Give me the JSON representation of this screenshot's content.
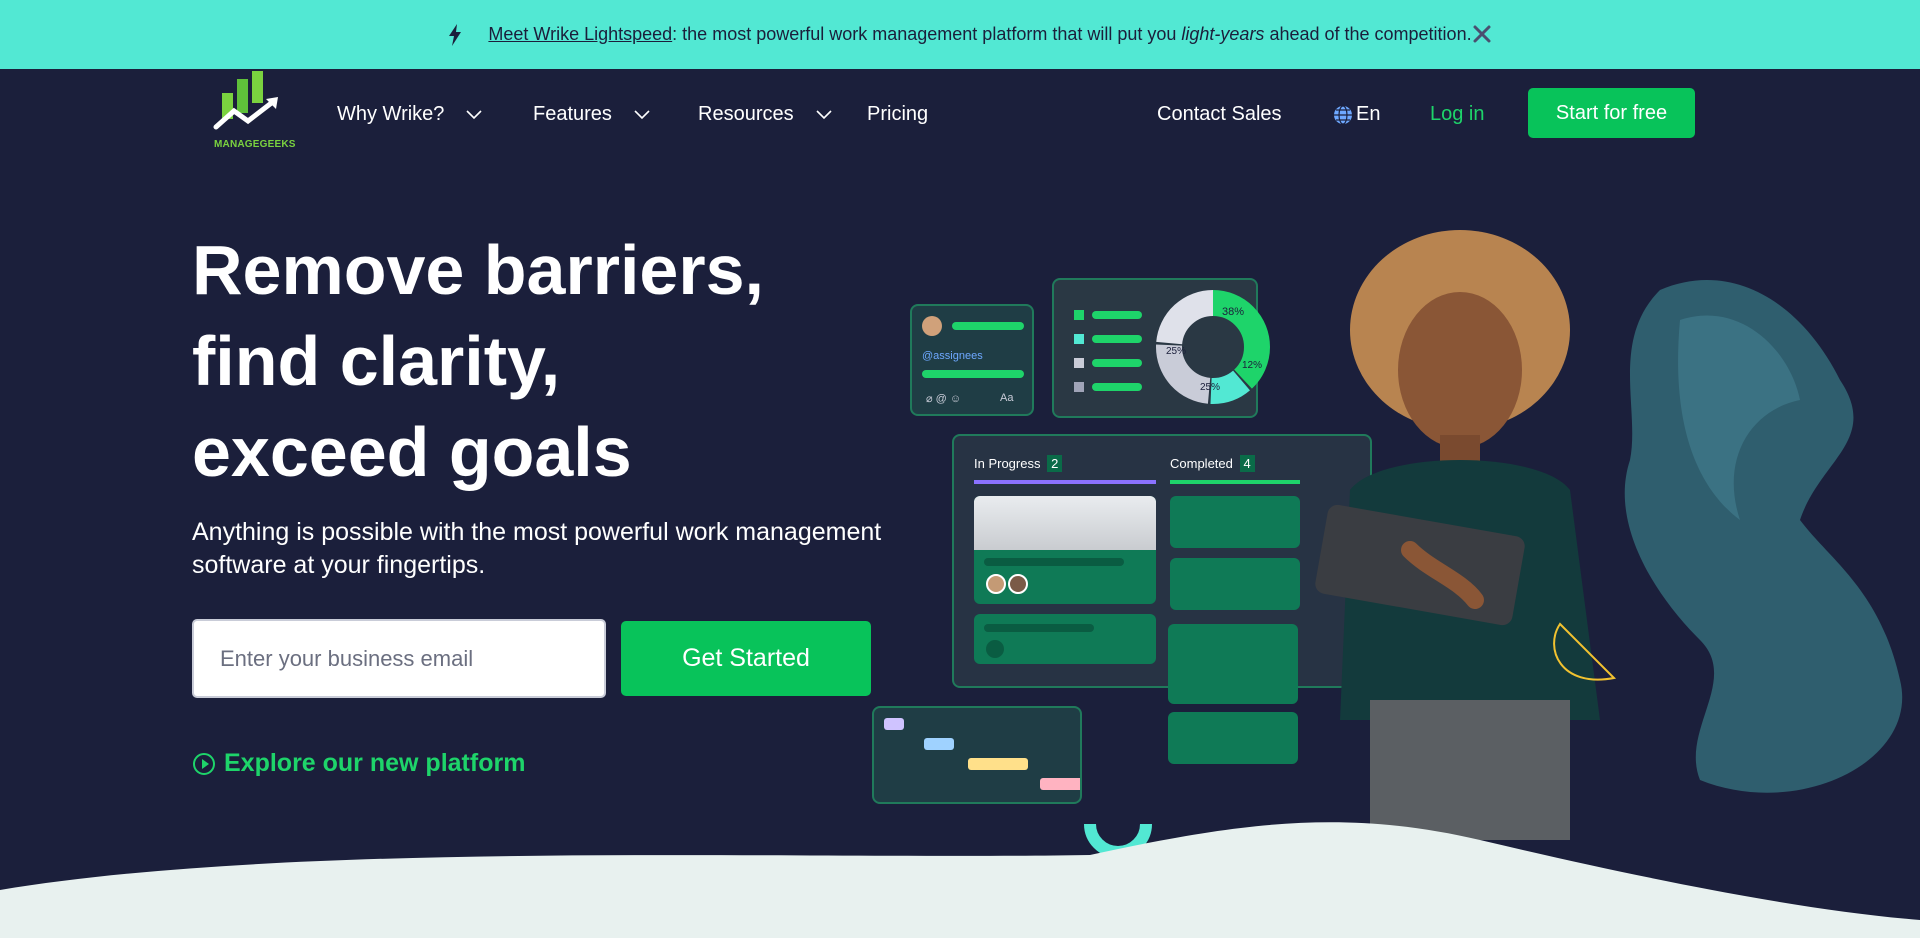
{
  "banner": {
    "link_text": "Meet Wrike Lightspeed",
    "text_before_italic": ": the most powerful work management platform that will put you ",
    "italic_text": "light-years",
    "text_after_italic": " ahead of the competition."
  },
  "nav": {
    "logo_text": "MANAGEGEEKS",
    "items": [
      {
        "label": "Why Wrike?",
        "has_dropdown": true
      },
      {
        "label": "Features",
        "has_dropdown": true
      },
      {
        "label": "Resources",
        "has_dropdown": true
      },
      {
        "label": "Pricing",
        "has_dropdown": false
      }
    ],
    "contact_sales": "Contact Sales",
    "language": "En",
    "login": "Log in",
    "start_free": "Start for free"
  },
  "hero": {
    "title_lines": [
      "Remove barriers,",
      "find clarity,",
      "exceed goals"
    ],
    "subtitle": "Anything is possible with the most powerful work management software at your fingertips.",
    "email_placeholder": "Enter your business email",
    "cta": "Get Started",
    "explore": "Explore our new platform"
  },
  "illustration": {
    "comment_mention": "@assignees",
    "comment_format": "Aa",
    "donut_labels": [
      "38%",
      "12%",
      "25%",
      "25%"
    ],
    "board": {
      "in_progress_label": "In Progress",
      "in_progress_count": "2",
      "completed_label": "Completed",
      "completed_count": "4"
    }
  },
  "colors": {
    "background": "#1b1f3b",
    "banner": "#52e8d3",
    "accent_green": "#08c35a",
    "link_green": "#1ed46a"
  }
}
